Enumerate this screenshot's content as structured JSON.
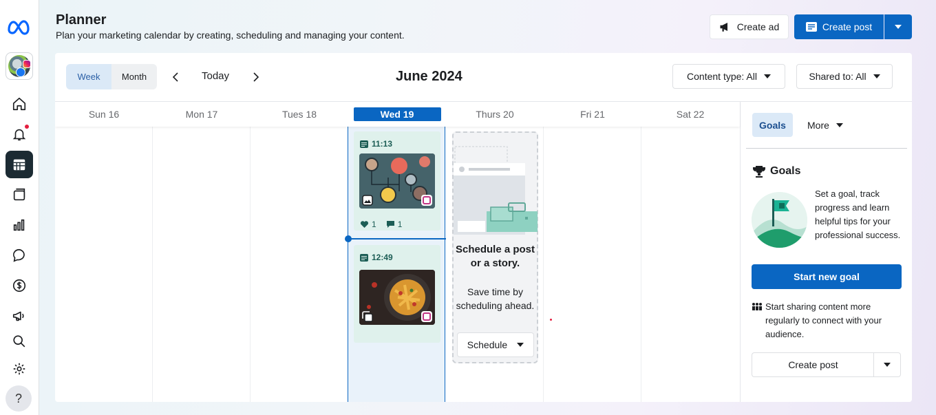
{
  "header": {
    "title": "Planner",
    "subtitle": "Plan your marketing calendar by creating, scheduling and managing your content.",
    "create_ad": "Create ad",
    "create_post": "Create post"
  },
  "toolbar": {
    "view_week": "Week",
    "view_month": "Month",
    "today": "Today",
    "month_title": "June 2024",
    "content_type": "Content type: All",
    "shared_to": "Shared to: All"
  },
  "days": [
    {
      "label": "Sun 16"
    },
    {
      "label": "Mon 17"
    },
    {
      "label": "Tues 18"
    },
    {
      "label": "Wed 19"
    },
    {
      "label": "Thurs 20"
    },
    {
      "label": "Fri 21"
    },
    {
      "label": "Sat 22"
    }
  ],
  "posts": [
    {
      "time": "11:13",
      "likes": "1",
      "comments": "1"
    },
    {
      "time": "12:49"
    }
  ],
  "schedule_card": {
    "title": "Schedule a post or a story.",
    "description": "Save time by scheduling ahead.",
    "button": "Schedule"
  },
  "side_panel": {
    "tab_goals": "Goals",
    "tab_more": "More",
    "goals_heading": "Goals",
    "goals_text": "Set a goal, track progress and learn helpful tips for your professional success.",
    "start_goal": "Start new goal",
    "tip": "Start sharing content more regularly to connect with your audience.",
    "create_post": "Create post"
  },
  "help": "?",
  "colors": {
    "accent": "#0a66c2",
    "post_bg": "#dff1ec",
    "today_col": "#e9f2fa"
  }
}
